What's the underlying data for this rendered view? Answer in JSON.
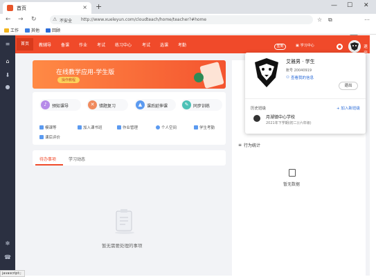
{
  "browser": {
    "tab_title": "首页",
    "security_label": "不安全",
    "url": "http://www.xueleyun.com/cloudteach/home/teacher?#home",
    "bookmarks": [
      {
        "label": "工作",
        "color": "#f2b51e"
      },
      {
        "label": "其他",
        "color": "#3b7de0"
      },
      {
        "label": "回顾",
        "color": "#2b6cd8"
      }
    ]
  },
  "nav": {
    "items": [
      "首页",
      "教辅导",
      "备课",
      "作业",
      "考试",
      "练习中心",
      "考试",
      "选课",
      "考勤"
    ],
    "ticket_label": "签到",
    "center_label": "学习中心",
    "user_label": "退出"
  },
  "banner": {
    "title": "在线教学应用-学生版",
    "button": "操作教程"
  },
  "quick_actions": [
    {
      "label": "预知课导",
      "color": "#b68be8",
      "icon": "♪"
    },
    {
      "label": "错题复习",
      "color": "#f08a5d",
      "icon": "✕"
    },
    {
      "label": "课后延伸课",
      "color": "#5b9af0",
      "icon": "▲"
    },
    {
      "label": "同步训练",
      "color": "#4cc1b6",
      "icon": "✎"
    }
  ],
  "quick_links": [
    "模课等",
    "加入课书班",
    "作业管理",
    "个人空间",
    "学生考勤",
    "课后评价"
  ],
  "tabs": {
    "todo": "待办事项",
    "learn": "学习动态"
  },
  "todo_empty": "暂无需要处理的事项",
  "right": {
    "section_title": "行为统计",
    "empty": "暂无数据"
  },
  "dropdown": {
    "name": "艾雅男 · 学生",
    "id_label": "账号 20040919",
    "info_link": "查看我的信息",
    "logout": "退出",
    "history_label": "历史班级",
    "join_label": "+ 加入新班级",
    "school_name": "月湖镇中心学校",
    "school_date": "2021年下学期(初二)(六年级)"
  },
  "status_url": "javascript:;"
}
